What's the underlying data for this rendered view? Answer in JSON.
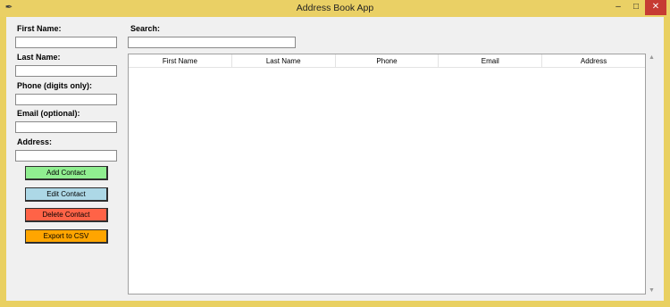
{
  "window": {
    "title": "Address Book App",
    "icon": "feather-icon",
    "controls": {
      "minimize": "–",
      "maximize": "□",
      "close": "✕"
    }
  },
  "form": {
    "first_name_label": "First Name:",
    "last_name_label": "Last Name:",
    "phone_label": "Phone (digits only):",
    "email_label": "Email (optional):",
    "address_label": "Address:",
    "first_name_value": "",
    "last_name_value": "",
    "phone_value": "",
    "email_value": "",
    "address_value": ""
  },
  "buttons": {
    "add": {
      "label": "Add Contact",
      "color": "#90ee90"
    },
    "edit": {
      "label": "Edit Contact",
      "color": "#add8e6"
    },
    "delete": {
      "label": "Delete Contact",
      "color": "#ff6347"
    },
    "export": {
      "label": "Export to CSV",
      "color": "#ffa500"
    }
  },
  "search": {
    "label": "Search:",
    "value": ""
  },
  "table": {
    "columns": [
      "First Name",
      "Last Name",
      "Phone",
      "Email",
      "Address"
    ],
    "rows": []
  }
}
